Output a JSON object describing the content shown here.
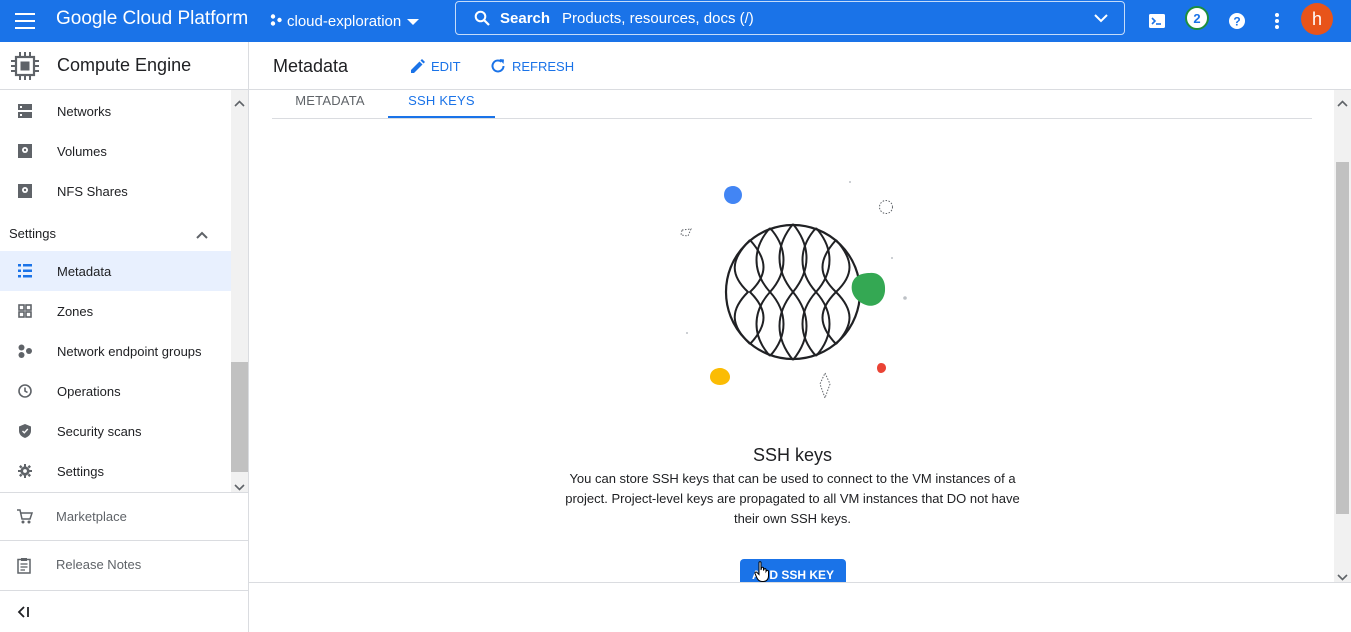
{
  "topbar": {
    "brand": "Google Cloud Platform",
    "project": "cloud-exploration",
    "search_label": "Search",
    "search_placeholder": "Products, resources, docs (/)",
    "notification_count": "2",
    "avatar_initial": "h",
    "icons": [
      "menu-icon",
      "project-icon",
      "search-icon",
      "chevron-down-icon",
      "cloud-shell-icon",
      "help-icon",
      "more-vert-icon"
    ]
  },
  "sidebar": {
    "product_title": "Compute Engine",
    "items_top": [
      {
        "label": "Networks",
        "icon": "networks-icon"
      },
      {
        "label": "Volumes",
        "icon": "volumes-icon"
      },
      {
        "label": "NFS Shares",
        "icon": "nfs-shares-icon"
      }
    ],
    "settings_header": "Settings",
    "items_settings": [
      {
        "label": "Metadata",
        "icon": "metadata-icon",
        "active": true
      },
      {
        "label": "Zones",
        "icon": "zones-icon"
      },
      {
        "label": "Network endpoint groups",
        "icon": "network-endpoint-groups-icon"
      },
      {
        "label": "Operations",
        "icon": "operations-icon"
      },
      {
        "label": "Security scans",
        "icon": "security-scans-icon"
      },
      {
        "label": "Settings",
        "icon": "settings-icon"
      }
    ],
    "marketplace": "Marketplace",
    "release_notes": "Release Notes"
  },
  "header": {
    "title": "Metadata",
    "edit": "EDIT",
    "refresh": "REFRESH"
  },
  "tabs": [
    {
      "label": "METADATA",
      "active": false
    },
    {
      "label": "SSH KEYS",
      "active": true
    }
  ],
  "empty_state": {
    "title": "SSH keys",
    "description": "You can store SSH keys that can be used to connect to the VM instances of a project. Project-level keys are propagated to all VM instances that DO not have their own SSH keys.",
    "button": "ADD SSH KEY"
  },
  "colors": {
    "accent": "#1a73e8",
    "active_bg": "#e8f0fe",
    "green": "#34a853",
    "yellow": "#fbbc04",
    "red": "#ea4335",
    "avatar": "#e8541a"
  }
}
